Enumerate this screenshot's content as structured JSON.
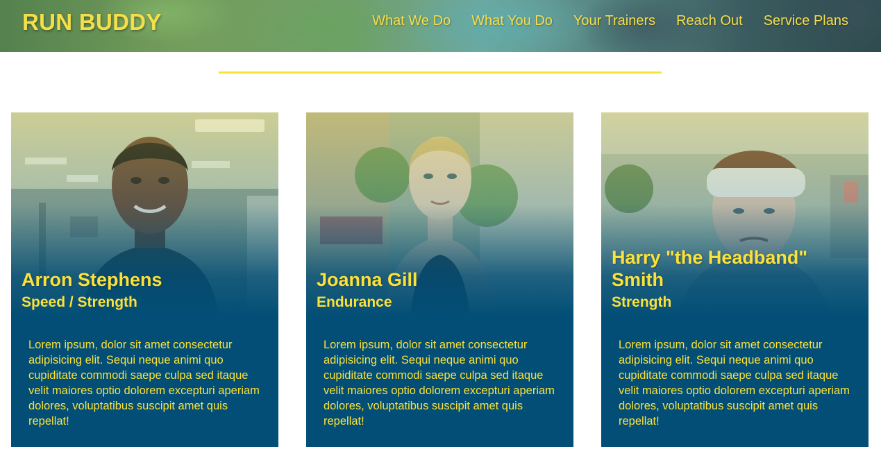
{
  "header": {
    "brand": "RUN BUDDY",
    "nav": [
      {
        "label": "What We Do"
      },
      {
        "label": "What You Do"
      },
      {
        "label": "Your Trainers"
      },
      {
        "label": "Reach Out"
      },
      {
        "label": "Service Plans"
      }
    ]
  },
  "trainers": [
    {
      "name": "Arron Stephens",
      "role": "Speed / Strength",
      "bio": "Lorem ipsum, dolor sit amet consectetur adipisicing elit. Sequi neque animi quo cupiditate commodi saepe culpa sed itaque velit maiores optio dolorem excepturi aperiam dolores, voluptatibus suscipit amet quis repellat!"
    },
    {
      "name": "Joanna Gill",
      "role": "Endurance",
      "bio": "Lorem ipsum, dolor sit amet consectetur adipisicing elit. Sequi neque animi quo cupiditate commodi saepe culpa sed itaque velit maiores optio dolorem excepturi aperiam dolores, voluptatibus suscipit amet quis repellat!"
    },
    {
      "name": "Harry \"the Headband\" Smith",
      "role": "Strength",
      "bio": "Lorem ipsum, dolor sit amet consectetur adipisicing elit. Sequi neque animi quo cupiditate commodi saepe culpa sed itaque velit maiores optio dolorem excepturi aperiam dolores, voluptatibus suscipit amet quis repellat!"
    }
  ],
  "colors": {
    "accent": "#fce138",
    "card_background": "#024e76"
  }
}
